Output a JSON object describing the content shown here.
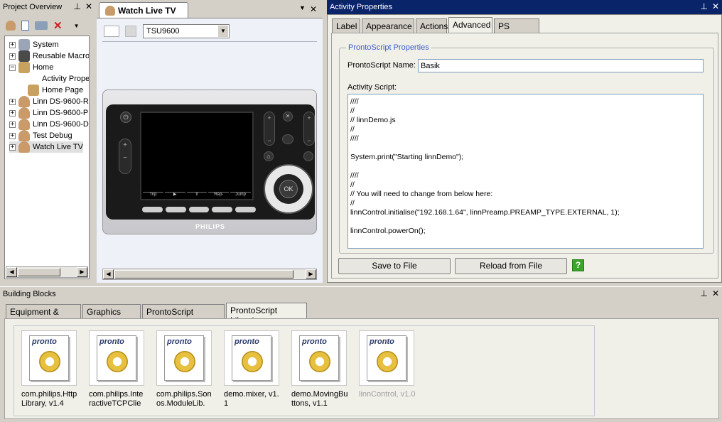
{
  "project_overview": {
    "title": "Project Overview",
    "tree": [
      {
        "label": "System",
        "expander": "+",
        "indent": 0
      },
      {
        "label": "Reusable Macros",
        "expander": "+",
        "indent": 0
      },
      {
        "label": "Home",
        "expander": "−",
        "indent": 0
      },
      {
        "label": "Activity Properties",
        "expander": "",
        "indent": 1
      },
      {
        "label": "Home Page",
        "expander": "",
        "indent": 1
      },
      {
        "label": "Linn DS-9600-R",
        "expander": "+",
        "indent": 0
      },
      {
        "label": "Linn DS-9600-P",
        "expander": "+",
        "indent": 0
      },
      {
        "label": "Linn DS-9600-D",
        "expander": "+",
        "indent": 0
      },
      {
        "label": "Test Debug",
        "expander": "+",
        "indent": 0
      },
      {
        "label": "Watch Live TV",
        "expander": "+",
        "indent": 0
      }
    ]
  },
  "editor": {
    "tab_title": "Watch Live TV",
    "device_select": "TSU9600",
    "brand": "PHILIPS",
    "soft_buttons": [
      "Trip",
      "▶",
      "II",
      "Rep-",
      "Jump"
    ],
    "ok_label": "OK"
  },
  "activity_properties": {
    "title": "Activity Properties",
    "tabs": [
      "Label",
      "Appearance",
      "Actions",
      "Advanced",
      "PS Libraries"
    ],
    "active_tab": "Advanced",
    "group_title": "ProntoScript Properties",
    "name_label": "ProntoScript Name:",
    "name_value": "Basik",
    "script_label": "Activity Script:",
    "script": "////\n//\n// linnDemo.js\n//\n////\n\nSystem.print(\"Starting linnDemo\");\n\n////\n//\n// You will need to change from below here:\n//\nlinnControl.initialise(\"192.168.1.64\", linnPreamp.PREAMP_TYPE.EXTERNAL, 1);\n\nlinnControl.powerOn();",
    "save_button": "Save to File",
    "reload_button": "Reload from File",
    "help_glyph": "?"
  },
  "building_blocks": {
    "title": "Building Blocks",
    "tabs": [
      "Equipment & Codes",
      "Graphics Gallery",
      "ProntoScript Modules",
      "ProntoScript Libraries"
    ],
    "active_tab": "ProntoScript Libraries",
    "libraries": [
      {
        "label": "com.philips.HttpLibrary, v1.4",
        "dimmed": false
      },
      {
        "label": "com.philips.InteractiveTCPClie",
        "dimmed": false
      },
      {
        "label": "com.philips.Sonos.ModuleLib.",
        "dimmed": false
      },
      {
        "label": "demo.mixer, v1.1",
        "dimmed": false
      },
      {
        "label": "demo.MovingButtons, v1.1",
        "dimmed": false
      },
      {
        "label": "linnControl, v1.0",
        "dimmed": true
      }
    ],
    "logo_text": "pronto"
  },
  "colors": {
    "titlebar_active": "#0a246a",
    "group_title": "#3a5fcd",
    "help_green": "#3aa52a"
  }
}
